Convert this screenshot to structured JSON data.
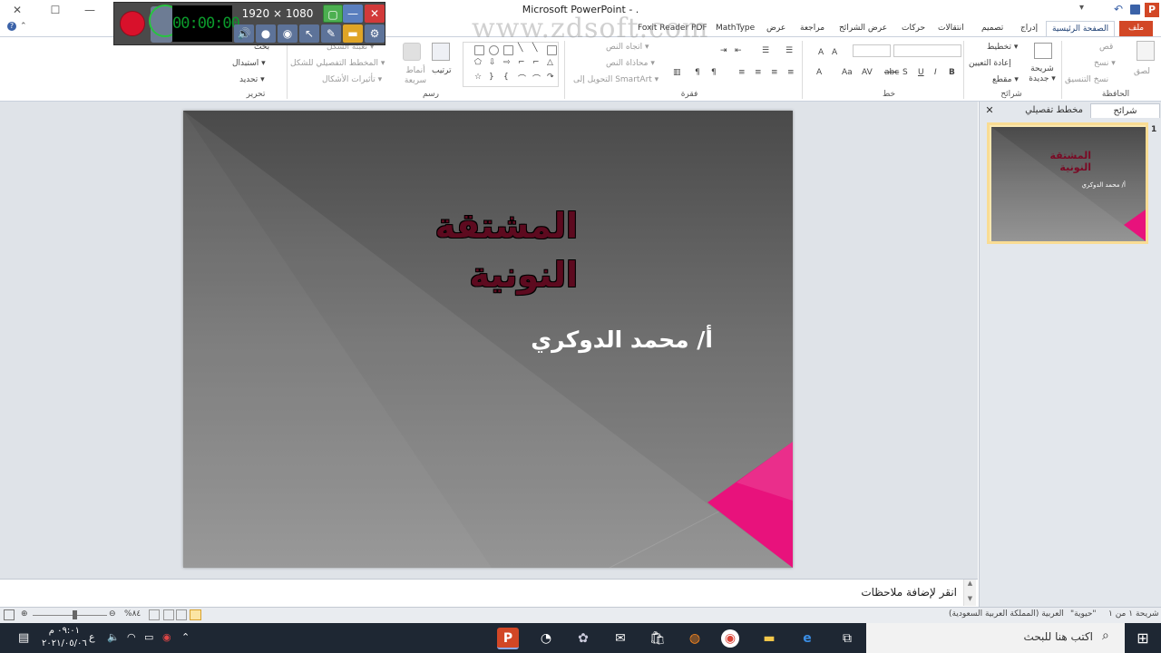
{
  "window": {
    "title": "Microsoft PowerPoint - .",
    "watermark": "www.zdsoft.com",
    "controls": {
      "minimize": "—",
      "maximize": "☐",
      "close": "✕"
    }
  },
  "quick_access": {
    "app_icon_letter": "P",
    "save_icon": "save-icon",
    "undo_icon": "undo-icon",
    "customize": "▾"
  },
  "recorder": {
    "timer": "00:00:00",
    "resolution": "1920 × 1080"
  },
  "ribbon_tabs": [
    {
      "label": "ملف"
    },
    {
      "label": "الصفحة الرئيسية"
    },
    {
      "label": "إدراج"
    },
    {
      "label": "تصميم"
    },
    {
      "label": "انتقالات"
    },
    {
      "label": "حركات"
    },
    {
      "label": "عرض الشرائح"
    },
    {
      "label": "مراجعة"
    },
    {
      "label": "عرض"
    },
    {
      "label": "MathType"
    },
    {
      "label": "Foxit Reader PDF"
    }
  ],
  "ribbon": {
    "clipboard": {
      "label": "الحافظة",
      "paste": "لصق",
      "cut": "قص",
      "copy": "نسخ ▾",
      "format_painter": "نسخ التنسيق"
    },
    "slides": {
      "label": "شرائح",
      "new_slide": "شريحة جديدة ▾",
      "layout": "تخطيط ▾",
      "reset": "إعادة التعيين",
      "section": "مقطع ▾"
    },
    "font": {
      "label": "خط"
    },
    "paragraph": {
      "label": "فقرة",
      "text_direction": "اتجاه النص ▾",
      "align_text": "محاذاة النص ▾",
      "smartart": "التحويل إلى SmartArt ▾"
    },
    "drawing": {
      "label": "رسم",
      "arrange": "ترتيب",
      "quick_styles": "أنماط سريعة",
      "shape_fill": "تعبئة الشكل ▾",
      "shape_outline": "المخطط التفصيلي للشكل ▾",
      "shape_effects": "تأثيرات الأشكال ▾"
    },
    "editing": {
      "label": "تحرير",
      "find": "بحث",
      "replace": "استبدال ▾",
      "select": "تحديد ▾"
    }
  },
  "slide": {
    "title_line1": "المشتقة",
    "title_line2": "النونية",
    "subtitle": "أ/ محمد الدوكري"
  },
  "slides_pane": {
    "tab_slides": "شرائح",
    "tab_outline": "مخطط تفصيلي",
    "close": "✕",
    "thumbnails": [
      {
        "number": "1",
        "title_line1": "المشتقة",
        "title_line2": "النونية",
        "subtitle": "أ/ محمد الدوكري"
      }
    ]
  },
  "notes": {
    "placeholder": "انقر لإضافة ملاحظات"
  },
  "statusbar": {
    "slide_info": "شريحة ١ من ١",
    "theme": "\"حيوية\"",
    "language": "العربية (المملكة العربية السعودية)",
    "zoom": "%٨٤"
  },
  "taskbar": {
    "search_placeholder": "اكتب هنا للبحث",
    "time": "٠٩:٠١ م",
    "date": "٢٠٢١/٠٥/٠٦",
    "lang": "ع"
  },
  "colors": {
    "accent": "#d24726",
    "slide_pink": "#e8127c",
    "title_color": "#5d0a1f",
    "taskbar": "#1e2733"
  }
}
